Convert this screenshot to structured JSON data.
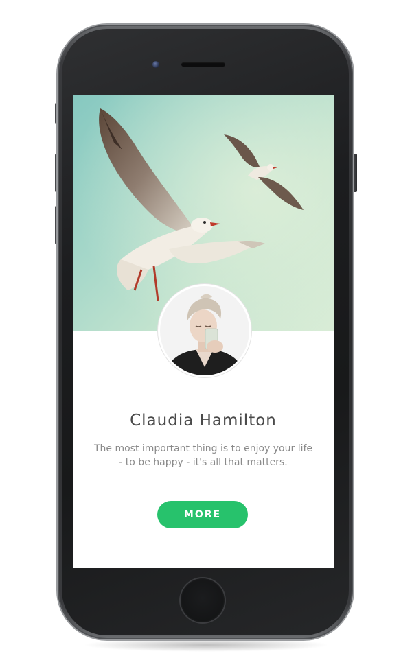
{
  "profile": {
    "name": "Claudia Hamilton",
    "quote": "The most important thing is to enjoy your life - to be happy - it's all that matters.",
    "more_label": "MORE"
  },
  "colors": {
    "accent": "#27c26c",
    "cover_sky": "#a5d7c9",
    "name_text": "#4a4a4a",
    "quote_text": "#8a8a8a",
    "phone_body": "#1c1d1f"
  },
  "icons": {
    "camera": "front-camera-icon",
    "speaker": "earpiece-speaker-icon",
    "home": "home-button-icon"
  }
}
